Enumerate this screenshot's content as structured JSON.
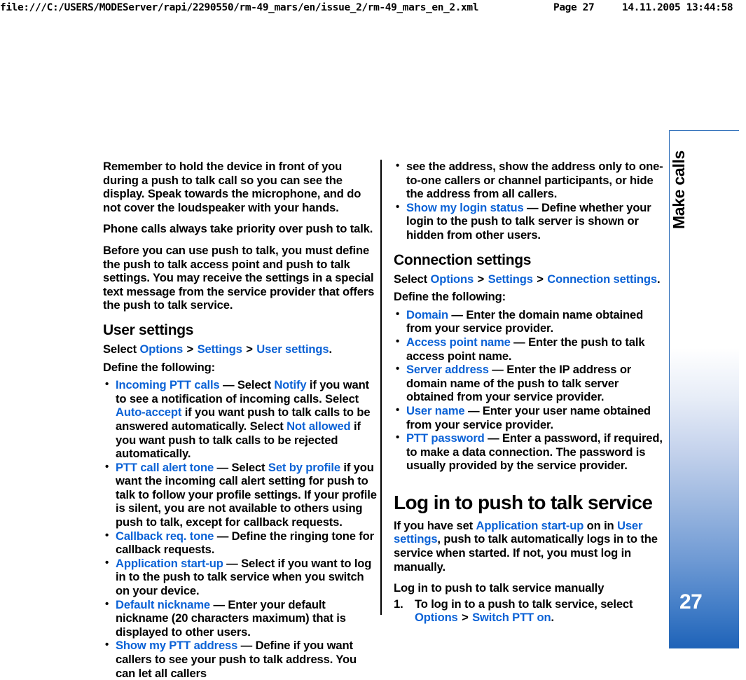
{
  "print_header": {
    "url": "file:///C:/USERS/MODEServer/rapi/2290550/rm-49_mars/en/issue_2/rm-49_mars_en_2.xml",
    "page": "Page 27",
    "datetime": "14.11.2005 13:44:58"
  },
  "edge_tab": {
    "chapter_title": "Make calls",
    "page_number": "27",
    "border_color": "#2b6cb8",
    "gradient_end_color": "#1f63b8"
  },
  "link_color": "#0b62d6",
  "left_column": {
    "paragraphs": {
      "p1": "Remember to hold the device in front of you during a push to talk call so you can see the display. Speak towards the microphone, and do not cover the loudspeaker with your hands.",
      "p2": "Phone calls always take priority over push to talk.",
      "p3": "Before you can use push to talk, you must define the push to talk access point and push to talk settings. You may receive the settings in a special text message from the service provider that offers the push to talk service."
    },
    "user_settings": {
      "heading": "User settings",
      "select_prefix": "Select ",
      "select_path": [
        "Options",
        "Settings",
        "User settings"
      ],
      "select_suffix": ".",
      "define_line": "Define the following:",
      "bullets": [
        {
          "term": "Incoming PTT calls",
          "parts": [
            {
              "t": "text",
              "v": " — Select "
            },
            {
              "t": "link",
              "v": "Notify"
            },
            {
              "t": "text",
              "v": " if you want to see a notification of incoming calls. Select "
            },
            {
              "t": "link",
              "v": "Auto-accept"
            },
            {
              "t": "text",
              "v": " if you want push to talk calls to be answered automatically. Select "
            },
            {
              "t": "link",
              "v": "Not allowed"
            },
            {
              "t": "text",
              "v": " if you want push to talk calls to be rejected automatically."
            }
          ]
        },
        {
          "term": "PTT call alert tone",
          "parts": [
            {
              "t": "text",
              "v": " — Select "
            },
            {
              "t": "link",
              "v": "Set by profile"
            },
            {
              "t": "text",
              "v": " if you want the incoming call alert setting for push to talk to follow your profile settings. If your profile is silent, you are not available to others using push to talk, except for callback requests."
            }
          ]
        },
        {
          "term": "Callback req. tone",
          "parts": [
            {
              "t": "text",
              "v": " — Define the ringing tone for callback requests."
            }
          ]
        },
        {
          "term": "Application start-up",
          "parts": [
            {
              "t": "text",
              "v": " — Select if you want to log in to the push to talk service when you switch on your device."
            }
          ]
        },
        {
          "term": "Default nickname",
          "parts": [
            {
              "t": "text",
              "v": " — Enter your default nickname (20 characters maximum) that is displayed to other users."
            }
          ]
        },
        {
          "term": "Show my PTT address",
          "parts": [
            {
              "t": "text",
              "v": " — Define if you want callers to see your push to talk address. You can let all callers"
            }
          ]
        }
      ]
    }
  },
  "right_column": {
    "continuation": "see the address, show the address only to one-to-one callers or channel participants, or hide the address from all callers.",
    "continuation_bullet": {
      "term": "Show my login status",
      "parts": [
        {
          "t": "text",
          "v": " — Define whether your login to the push to talk server is shown or hidden from other users."
        }
      ]
    },
    "connection_settings": {
      "heading": "Connection settings",
      "select_prefix": "Select ",
      "select_path": [
        "Options",
        "Settings",
        "Connection settings"
      ],
      "select_suffix": ".",
      "define_line": "Define the following:",
      "bullets": [
        {
          "term": "Domain",
          "parts": [
            {
              "t": "text",
              "v": " — Enter the domain name obtained from your service provider."
            }
          ]
        },
        {
          "term": "Access point name",
          "parts": [
            {
              "t": "text",
              "v": " — Enter the push to talk access point name."
            }
          ]
        },
        {
          "term": "Server address",
          "parts": [
            {
              "t": "text",
              "v": " — Enter the IP address or domain name of the push to talk server obtained from your service provider."
            }
          ]
        },
        {
          "term": "User name",
          "parts": [
            {
              "t": "text",
              "v": " — Enter your user name obtained from your service provider."
            }
          ]
        },
        {
          "term": "PTT password",
          "parts": [
            {
              "t": "text",
              "v": " — Enter a password, if required, to make a data connection. The password is usually provided by the service provider."
            }
          ]
        }
      ]
    },
    "login_section": {
      "heading": "Log in to push to talk service",
      "intro_parts": [
        {
          "t": "text",
          "v": "If you have set "
        },
        {
          "t": "link",
          "v": "Application start-up"
        },
        {
          "t": "text",
          "v": " on in "
        },
        {
          "t": "link",
          "v": "User settings"
        },
        {
          "t": "text",
          "v": ", push to talk automatically logs in to the service when started. If not, you must log in manually."
        }
      ],
      "subheading": "Log in to push to talk service manually",
      "steps": [
        {
          "parts": [
            {
              "t": "text",
              "v": "To log in to a push to talk service, select "
            },
            {
              "t": "link",
              "v": "Options"
            },
            {
              "t": "gt",
              "v": ">"
            },
            {
              "t": "link",
              "v": "Switch PTT on"
            },
            {
              "t": "text",
              "v": "."
            }
          ]
        }
      ]
    }
  }
}
